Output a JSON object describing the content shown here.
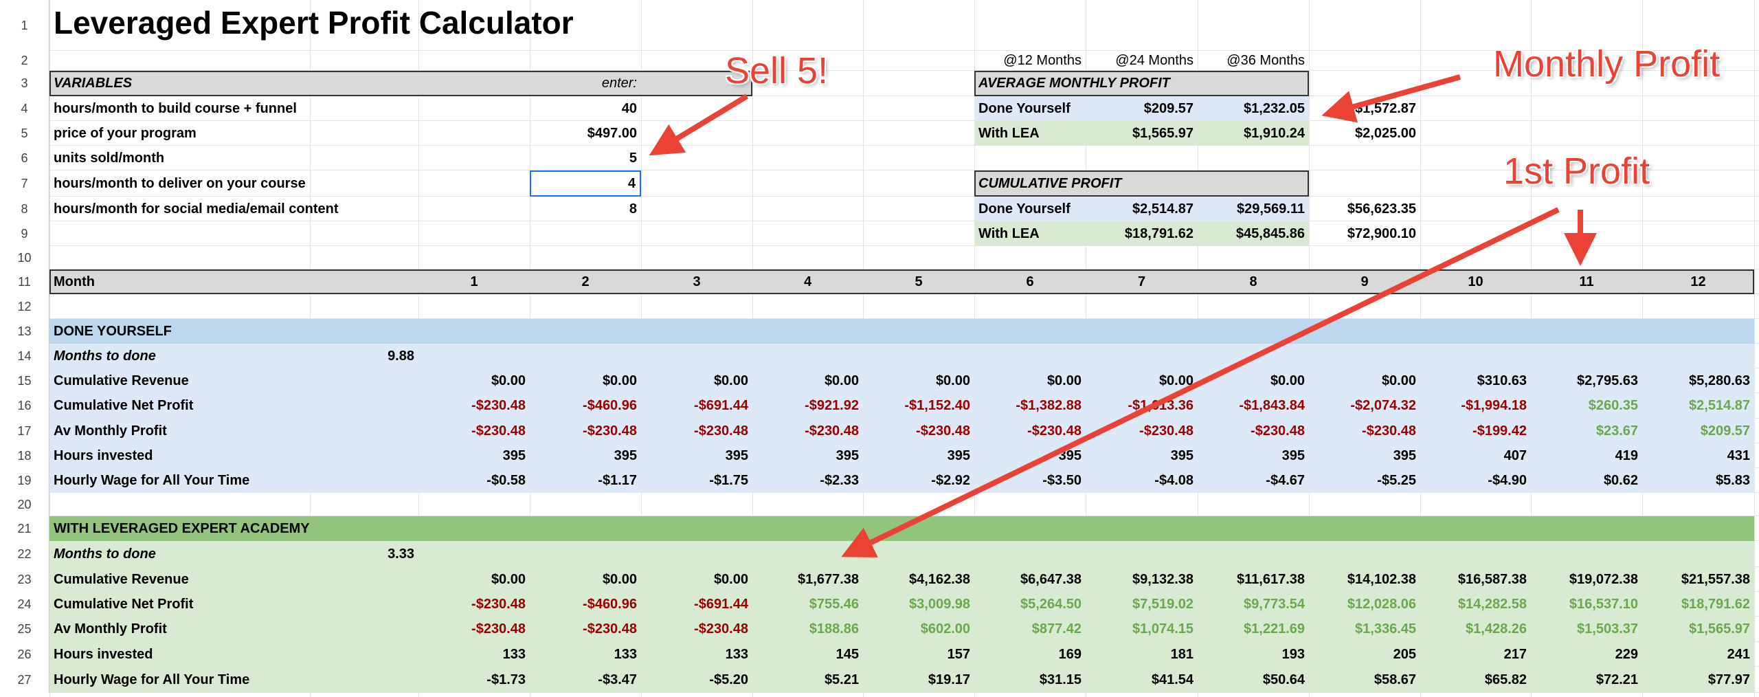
{
  "title": "Leveraged Expert Profit Calculator",
  "row_numbers": [
    "1",
    "2",
    "3",
    "4",
    "5",
    "6",
    "7",
    "8",
    "9",
    "10",
    "11",
    "12",
    "13",
    "14",
    "15",
    "16",
    "17",
    "18",
    "19",
    "20",
    "21",
    "22",
    "23",
    "24",
    "25",
    "26",
    "27"
  ],
  "variables": {
    "header": "VARIABLES",
    "enter_label": "enter:",
    "rows": [
      {
        "label": "hours/month to build course + funnel",
        "value": "40"
      },
      {
        "label": "price of your program",
        "value": "$497.00"
      },
      {
        "label": "units sold/month",
        "value": "5"
      },
      {
        "label": "hours/month to deliver on your course",
        "value": "4"
      },
      {
        "label": "hours/month for social media/email content",
        "value": "8"
      }
    ]
  },
  "horizons": [
    "@12 Months",
    "@24 Months",
    "@36 Months"
  ],
  "avg_monthly": {
    "header": "AVERAGE MONTHLY PROFIT",
    "rows": [
      {
        "label": "Done Yourself",
        "values": [
          "$209.57",
          "$1,232.05",
          "$1,572.87"
        ]
      },
      {
        "label": "With LEA",
        "values": [
          "$1,565.97",
          "$1,910.24",
          "$2,025.00"
        ]
      }
    ]
  },
  "cumulative": {
    "header": "CUMULATIVE PROFIT",
    "rows": [
      {
        "label": "Done Yourself",
        "values": [
          "$2,514.87",
          "$29,569.11",
          "$56,623.35"
        ]
      },
      {
        "label": "With LEA",
        "values": [
          "$18,791.62",
          "$45,845.86",
          "$72,900.10"
        ]
      }
    ]
  },
  "month_header": {
    "label": "Month",
    "months": [
      "1",
      "2",
      "3",
      "4",
      "5",
      "6",
      "7",
      "8",
      "9",
      "10",
      "11",
      "12"
    ]
  },
  "done_yourself": {
    "header": "DONE YOURSELF",
    "months_to_done_label": "Months to done",
    "months_to_done": "9.88",
    "rows": [
      {
        "label": "Cumulative Revenue",
        "values": [
          "$0.00",
          "$0.00",
          "$0.00",
          "$0.00",
          "$0.00",
          "$0.00",
          "$0.00",
          "$0.00",
          "$0.00",
          "$310.63",
          "$2,795.63",
          "$5,280.63"
        ]
      },
      {
        "label": "Cumulative Net Profit",
        "values": [
          "-$230.48",
          "-$460.96",
          "-$691.44",
          "-$921.92",
          "-$1,152.40",
          "-$1,382.88",
          "-$1,613.36",
          "-$1,843.84",
          "-$2,074.32",
          "-$1,994.18",
          "$260.35",
          "$2,514.87"
        ]
      },
      {
        "label": "Av Monthly Profit",
        "values": [
          "-$230.48",
          "-$230.48",
          "-$230.48",
          "-$230.48",
          "-$230.48",
          "-$230.48",
          "-$230.48",
          "-$230.48",
          "-$230.48",
          "-$199.42",
          "$23.67",
          "$209.57"
        ]
      },
      {
        "label": "Hours invested",
        "values": [
          "395",
          "395",
          "395",
          "395",
          "395",
          "395",
          "395",
          "395",
          "395",
          "407",
          "419",
          "431"
        ]
      },
      {
        "label": "Hourly Wage for All Your Time",
        "values": [
          "-$0.58",
          "-$1.17",
          "-$1.75",
          "-$2.33",
          "-$2.92",
          "-$3.50",
          "-$4.08",
          "-$4.67",
          "-$5.25",
          "-$4.90",
          "$0.62",
          "$5.83"
        ]
      }
    ]
  },
  "with_lea": {
    "header": "WITH LEVERAGED EXPERT ACADEMY",
    "months_to_done_label": "Months to done",
    "months_to_done": "3.33",
    "rows": [
      {
        "label": "Cumulative Revenue",
        "values": [
          "$0.00",
          "$0.00",
          "$0.00",
          "$1,677.38",
          "$4,162.38",
          "$6,647.38",
          "$9,132.38",
          "$11,617.38",
          "$14,102.38",
          "$16,587.38",
          "$19,072.38",
          "$21,557.38"
        ]
      },
      {
        "label": "Cumulative Net Profit",
        "values": [
          "-$230.48",
          "-$460.96",
          "-$691.44",
          "$755.46",
          "$3,009.98",
          "$5,264.50",
          "$7,519.02",
          "$9,773.54",
          "$12,028.06",
          "$14,282.58",
          "$16,537.10",
          "$18,791.62"
        ]
      },
      {
        "label": "Av Monthly Profit",
        "values": [
          "-$230.48",
          "-$230.48",
          "-$230.48",
          "$188.86",
          "$602.00",
          "$877.42",
          "$1,074.15",
          "$1,221.69",
          "$1,336.45",
          "$1,428.26",
          "$1,503.37",
          "$1,565.97"
        ]
      },
      {
        "label": "Hours invested",
        "values": [
          "133",
          "133",
          "133",
          "145",
          "157",
          "169",
          "181",
          "193",
          "205",
          "217",
          "229",
          "241"
        ]
      },
      {
        "label": "Hourly Wage for All Your Time",
        "values": [
          "-$1.73",
          "-$3.47",
          "-$5.20",
          "$5.21",
          "$19.17",
          "$31.15",
          "$41.54",
          "$50.64",
          "$58.67",
          "$65.82",
          "$72.21",
          "$77.97"
        ]
      }
    ]
  },
  "annotations": {
    "sell": "Sell 5!",
    "monthly_profit": "Monthly Profit",
    "first_profit": "1st Profit"
  },
  "colors": {
    "header_gray": "#d9d9d9",
    "blue_band": "#bdd7ee",
    "blue_light": "#dde9f6",
    "green_band": "#93c47d",
    "green_light": "#d9ead3",
    "negative": "#990000",
    "positive": "#6aa84f",
    "annotation": "#ea4335"
  }
}
